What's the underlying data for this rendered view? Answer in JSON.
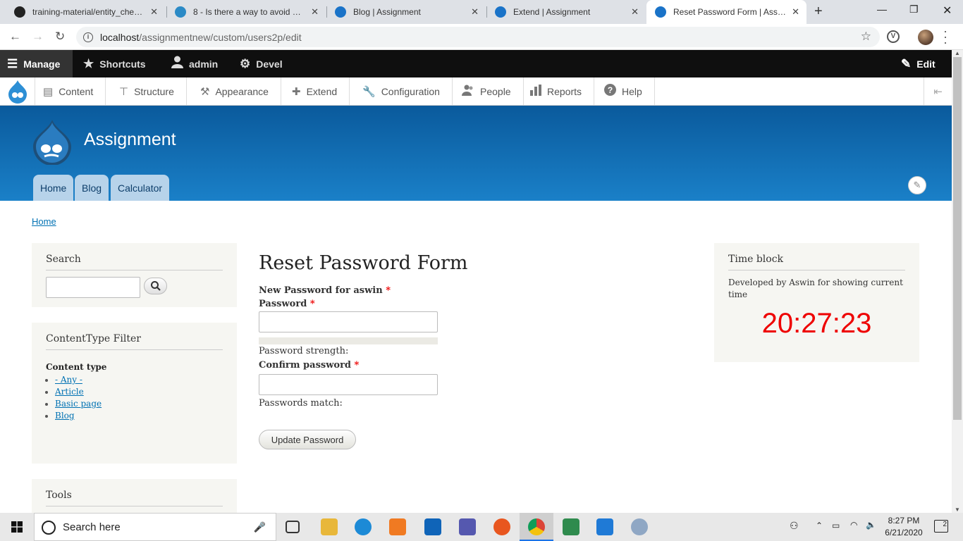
{
  "browser": {
    "tabs": [
      {
        "title": "training-material/entity_check..",
        "icon": "github-icon"
      },
      {
        "title": "8 - Is there a way to avoid and...",
        "icon": "drupal-drop-icon"
      },
      {
        "title": "Blog | Assignment",
        "icon": "drupal-drop-icon"
      },
      {
        "title": "Extend | Assignment",
        "icon": "drupal-drop-icon"
      },
      {
        "title": "Reset Password Form | Assignm...",
        "icon": "drupal-drop-icon"
      }
    ],
    "url_host": "localhost",
    "url_path": "/assignmentnew/custom/users2p/edit"
  },
  "admin_bar": {
    "manage": "Manage",
    "shortcuts": "Shortcuts",
    "user": "admin",
    "devel": "Devel",
    "edit": "Edit"
  },
  "admin_tray": {
    "items": [
      "Content",
      "Structure",
      "Appearance",
      "Extend",
      "Configuration",
      "People",
      "Reports",
      "Help"
    ]
  },
  "site": {
    "name": "Assignment",
    "tabs": [
      "Home",
      "Blog",
      "Calculator"
    ]
  },
  "breadcrumb": "Home",
  "search_block": {
    "title": "Search"
  },
  "filter_block": {
    "title": "ContentType Filter",
    "label": "Content type",
    "options": [
      "- Any -",
      "Article",
      "Basic page",
      "Blog"
    ]
  },
  "tools_block": {
    "title": "Tools"
  },
  "form": {
    "title": "Reset Password Form",
    "new_password_label": "New Password for aswin",
    "password_label": "Password",
    "required_mark": "*",
    "strength_label": "Password strength:",
    "confirm_label": "Confirm password",
    "match_label": "Passwords match:",
    "submit": "Update Password"
  },
  "time_block": {
    "title": "Time block",
    "description": "Developed by Aswin for showing current time",
    "time": "20:27:23"
  },
  "taskbar": {
    "search_placeholder": "Search here",
    "clock_time": "8:27 PM",
    "clock_date": "6/21/2020",
    "notifications": "2"
  },
  "colors": {
    "drupal_blue": "#0071b3",
    "header_top": "#0a5a9c",
    "header_bottom": "#1a80c8",
    "clock_red": "#ee0000",
    "required_red": "#ee0000"
  }
}
